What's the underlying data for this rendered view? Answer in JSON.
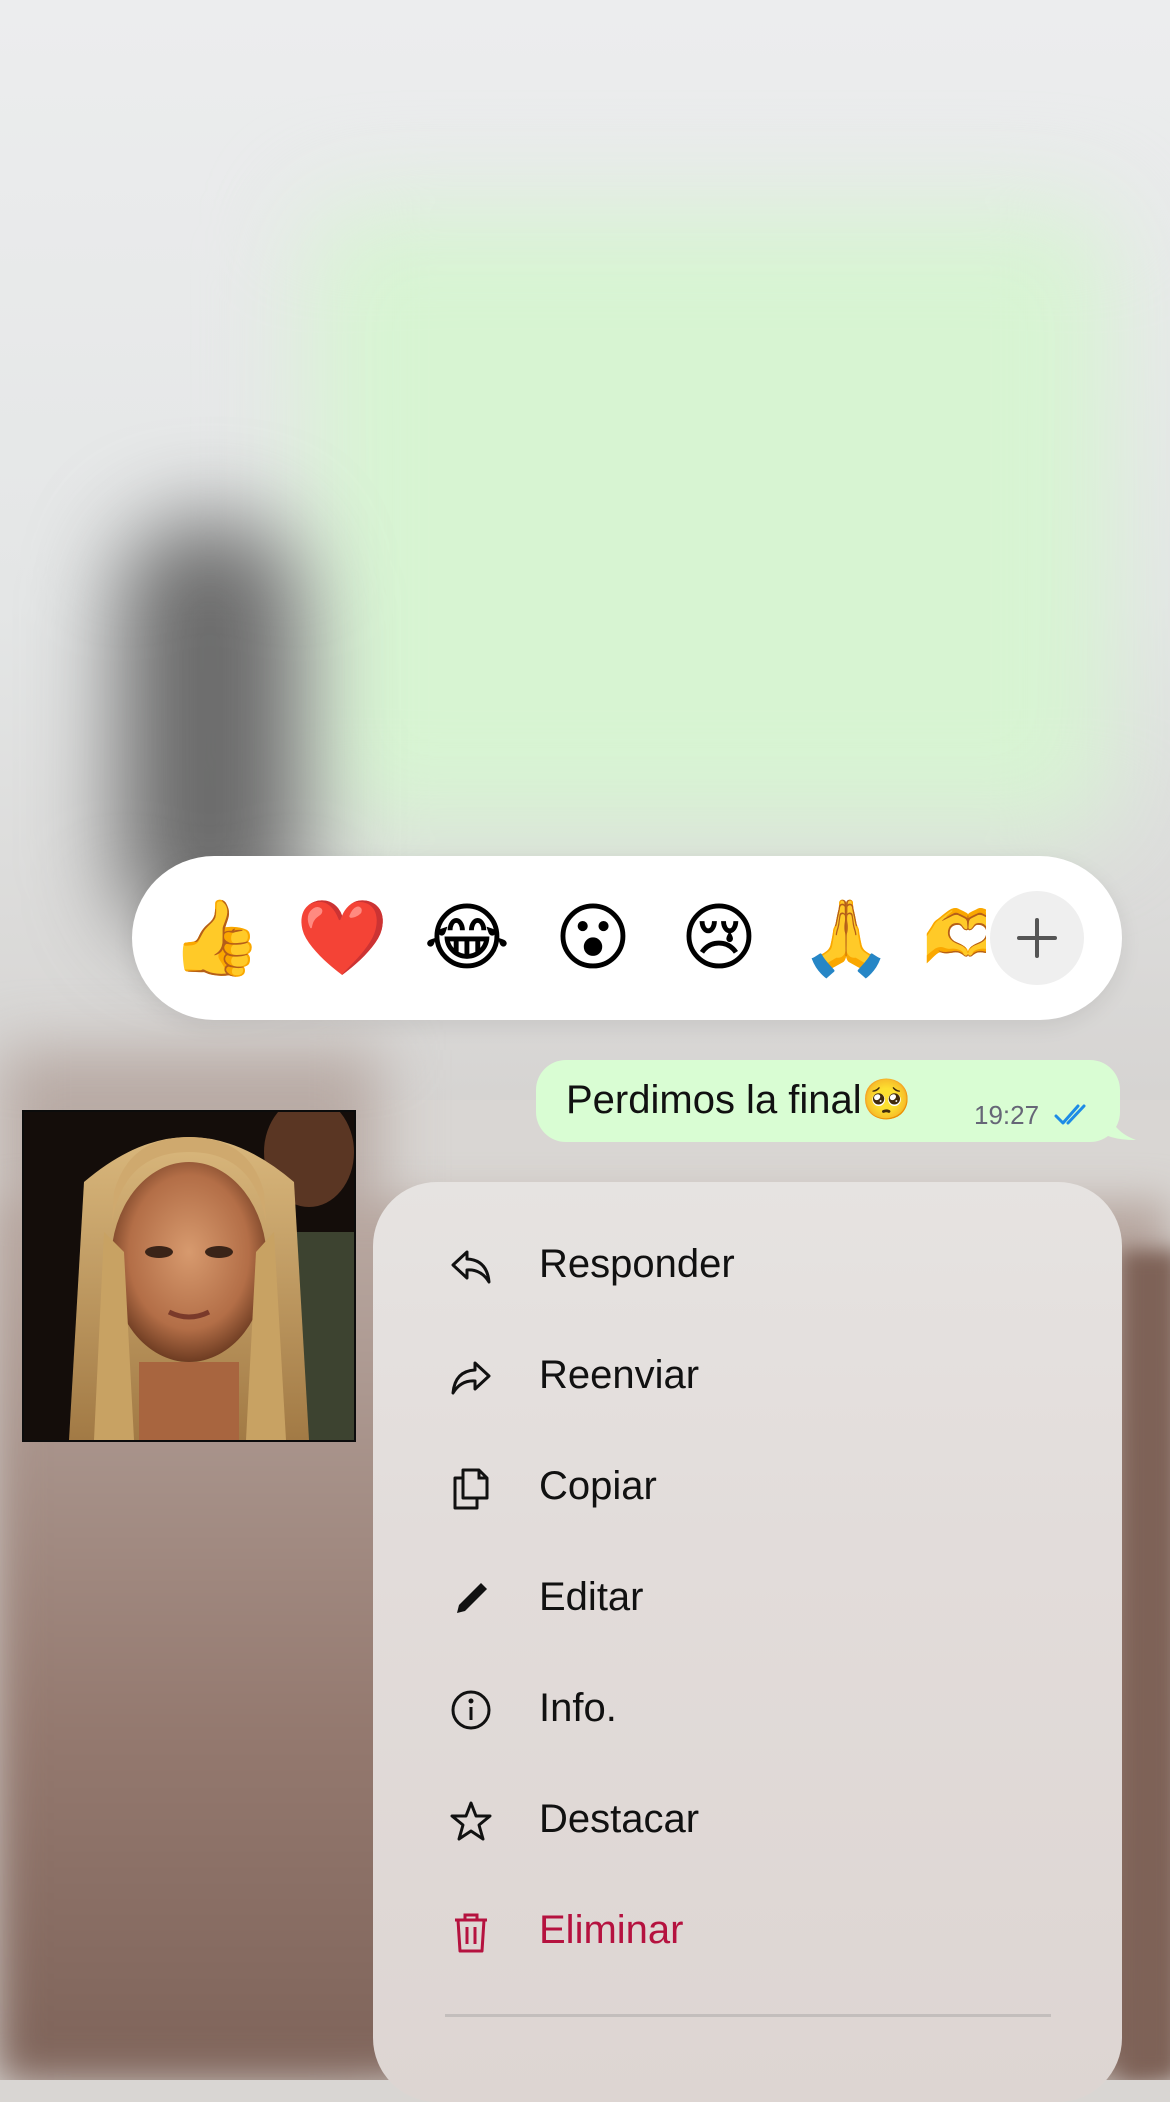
{
  "reactions": {
    "emojis": [
      {
        "name": "thumbs-up",
        "glyph": "👍"
      },
      {
        "name": "red-heart",
        "glyph": "❤️"
      },
      {
        "name": "tears-of-joy",
        "glyph": "😂"
      },
      {
        "name": "surprised-face",
        "glyph": "😮"
      },
      {
        "name": "crying-face",
        "glyph": "😢"
      },
      {
        "name": "folded-hands",
        "glyph": "🙏"
      },
      {
        "name": "partial-emoji",
        "glyph": "🫶"
      }
    ],
    "more_icon": "plus-icon"
  },
  "message": {
    "text": "Perdimos la final🥺",
    "time": "19:27",
    "status_icon": "double-check-icon",
    "status_color": "#1d8be6",
    "bubble_color": "#d9fdd3"
  },
  "sticker": {
    "description_icon": "sticker-image"
  },
  "menu": {
    "items": [
      {
        "label": "Responder",
        "icon": "reply-icon"
      },
      {
        "label": "Reenviar",
        "icon": "forward-icon"
      },
      {
        "label": "Copiar",
        "icon": "copy-icon"
      },
      {
        "label": "Editar",
        "icon": "pencil-icon"
      },
      {
        "label": "Info.",
        "icon": "info-icon"
      },
      {
        "label": "Destacar",
        "icon": "star-icon"
      },
      {
        "label": "Eliminar",
        "icon": "trash-icon",
        "color": "#b5123f"
      }
    ]
  }
}
